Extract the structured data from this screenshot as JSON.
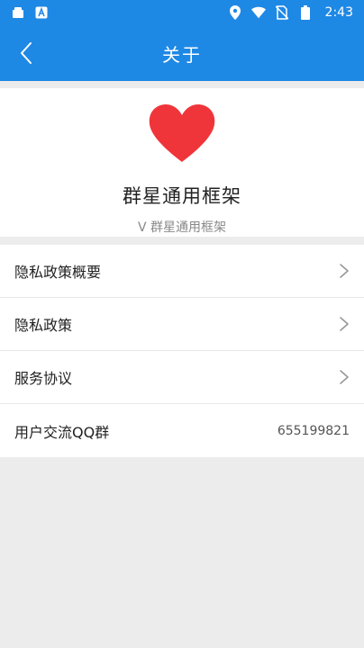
{
  "status_bar": {
    "time": "2:43",
    "icons": [
      "notification-icon",
      "android-icon",
      "location-icon",
      "wifi-icon",
      "no-sim-icon",
      "battery-icon"
    ]
  },
  "app_bar": {
    "title": "关于",
    "back_icon": "chevron-left-icon"
  },
  "about": {
    "logo_icon": "heart-icon",
    "app_name": "群星通用框架",
    "version": "V 群星通用框架"
  },
  "menu": {
    "items": [
      {
        "label": "隐私政策概要",
        "icon": "chevron-right-icon"
      },
      {
        "label": "隐私政策",
        "icon": "chevron-right-icon"
      },
      {
        "label": "服务协议",
        "icon": "chevron-right-icon"
      },
      {
        "label": "用户交流QQ群",
        "value": "655199821"
      }
    ]
  },
  "colors": {
    "primary": "#1e88e5",
    "heart": "#f0353a",
    "background": "#ececec"
  }
}
